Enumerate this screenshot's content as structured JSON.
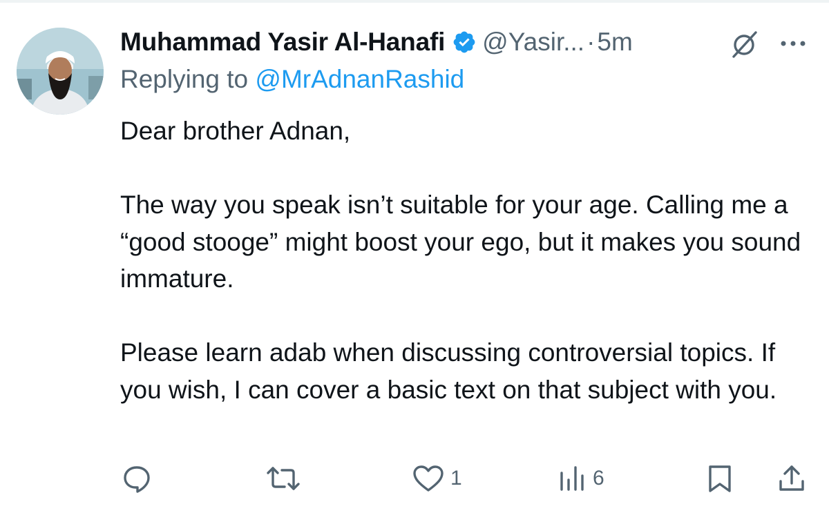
{
  "tweet": {
    "display_name": "Muhammad Yasir Al-Hanafi",
    "handle": "@Yasir...",
    "separator": "·",
    "time": "5m",
    "reply_prefix": "Replying to ",
    "reply_to": "@MrAdnanRashid",
    "paragraphs": [
      "Dear brother Adnan,",
      "The way you speak isn’t suitable for your age. Calling me a “good stooge” might boost your ego, but it makes you sound immature.",
      "Please learn adab when discussing controversial topics. If you wish, I can cover a basic text on that subject with you."
    ]
  },
  "actions": {
    "reply": {
      "icon": "reply-icon",
      "count": ""
    },
    "retweet": {
      "icon": "retweet-icon",
      "count": ""
    },
    "like": {
      "icon": "heart-icon",
      "count": "1"
    },
    "views": {
      "icon": "views-chart-icon",
      "count": "6"
    },
    "bookmark": {
      "icon": "bookmark-icon"
    },
    "share": {
      "icon": "share-icon"
    }
  },
  "colors": {
    "text": "#0f1419",
    "secondary": "#536471",
    "accent": "#1d9bf0"
  }
}
